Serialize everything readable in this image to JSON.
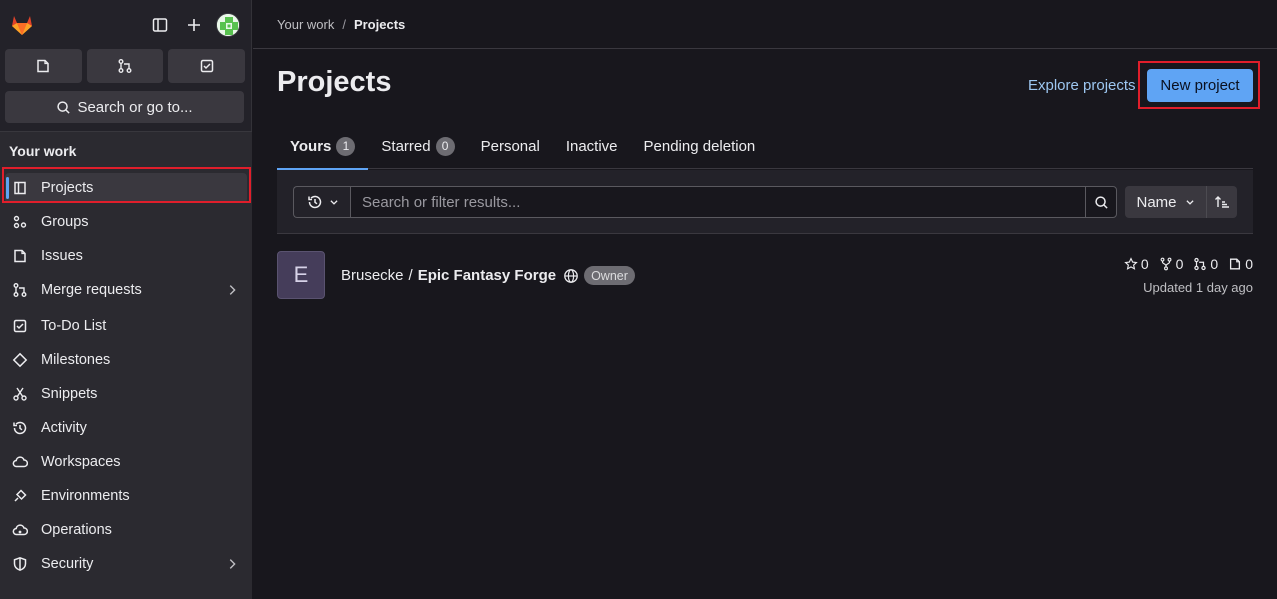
{
  "colors": {
    "accent": "#5fa4f4",
    "highlight_outline": "#e01e2b",
    "logo_orange": "#fc6d26"
  },
  "sidebar": {
    "heading": "Your work",
    "search_label": "Search or go to...",
    "items": [
      {
        "label": "Projects",
        "icon": "project-icon",
        "active": true
      },
      {
        "label": "Groups",
        "icon": "group-icon"
      },
      {
        "label": "Issues",
        "icon": "issues-icon"
      },
      {
        "label": "Merge requests",
        "icon": "merge-request-icon",
        "has_submenu": true
      },
      {
        "label": "To-Do List",
        "icon": "todo-icon"
      },
      {
        "label": "Milestones",
        "icon": "milestone-icon"
      },
      {
        "label": "Snippets",
        "icon": "snippet-icon"
      },
      {
        "label": "Activity",
        "icon": "history-icon"
      },
      {
        "label": "Workspaces",
        "icon": "cloud-icon"
      },
      {
        "label": "Environments",
        "icon": "environment-icon"
      },
      {
        "label": "Operations",
        "icon": "cloud-gear-icon"
      },
      {
        "label": "Security",
        "icon": "shield-icon",
        "has_submenu": true
      }
    ]
  },
  "breadcrumb": {
    "parent": "Your work",
    "separator": "/",
    "current": "Projects"
  },
  "page": {
    "title": "Projects",
    "explore_link": "Explore projects",
    "new_project_button": "New project"
  },
  "tabs": [
    {
      "label": "Yours",
      "count": "1",
      "active": true
    },
    {
      "label": "Starred",
      "count": "0"
    },
    {
      "label": "Personal"
    },
    {
      "label": "Inactive"
    },
    {
      "label": "Pending deletion"
    }
  ],
  "filter": {
    "placeholder": "Search or filter results...",
    "sort_label": "Name"
  },
  "projects": [
    {
      "avatar_letter": "E",
      "namespace": "Brusecke",
      "separator": "/",
      "name": "Epic Fantasy Forge",
      "role": "Owner",
      "stars": "0",
      "forks": "0",
      "merge_requests": "0",
      "issues": "0",
      "updated": "Updated 1 day ago"
    }
  ]
}
